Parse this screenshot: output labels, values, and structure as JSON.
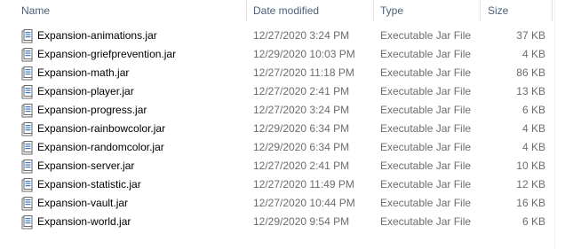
{
  "columns": {
    "name": "Name",
    "date_modified": "Date modified",
    "type": "Type",
    "size": "Size"
  },
  "files": [
    {
      "name": "Expansion-animations.jar",
      "date": "12/27/2020 3:24 PM",
      "type": "Executable Jar File",
      "size": "37 KB",
      "icon": "jar-file-icon"
    },
    {
      "name": "Expansion-griefprevention.jar",
      "date": "12/29/2020 10:03 PM",
      "type": "Executable Jar File",
      "size": "4 KB",
      "icon": "jar-file-icon"
    },
    {
      "name": "Expansion-math.jar",
      "date": "12/27/2020 11:18 PM",
      "type": "Executable Jar File",
      "size": "86 KB",
      "icon": "jar-file-icon"
    },
    {
      "name": "Expansion-player.jar",
      "date": "12/27/2020 2:41 PM",
      "type": "Executable Jar File",
      "size": "13 KB",
      "icon": "jar-file-icon"
    },
    {
      "name": "Expansion-progress.jar",
      "date": "12/27/2020 3:24 PM",
      "type": "Executable Jar File",
      "size": "6 KB",
      "icon": "jar-file-icon"
    },
    {
      "name": "Expansion-rainbowcolor.jar",
      "date": "12/29/2020 6:34 PM",
      "type": "Executable Jar File",
      "size": "4 KB",
      "icon": "jar-file-icon"
    },
    {
      "name": "Expansion-randomcolor.jar",
      "date": "12/29/2020 6:34 PM",
      "type": "Executable Jar File",
      "size": "4 KB",
      "icon": "jar-file-icon"
    },
    {
      "name": "Expansion-server.jar",
      "date": "12/27/2020 2:41 PM",
      "type": "Executable Jar File",
      "size": "10 KB",
      "icon": "jar-file-icon"
    },
    {
      "name": "Expansion-statistic.jar",
      "date": "12/27/2020 11:49 PM",
      "type": "Executable Jar File",
      "size": "12 KB",
      "icon": "jar-file-icon"
    },
    {
      "name": "Expansion-vault.jar",
      "date": "12/27/2020 10:44 PM",
      "type": "Executable Jar File",
      "size": "16 KB",
      "icon": "jar-file-icon"
    },
    {
      "name": "Expansion-world.jar",
      "date": "12/29/2020 9:54 PM",
      "type": "Executable Jar File",
      "size": "6 KB",
      "icon": "jar-file-icon"
    }
  ],
  "sort_indicator_icon": "sort-chevron-icon"
}
